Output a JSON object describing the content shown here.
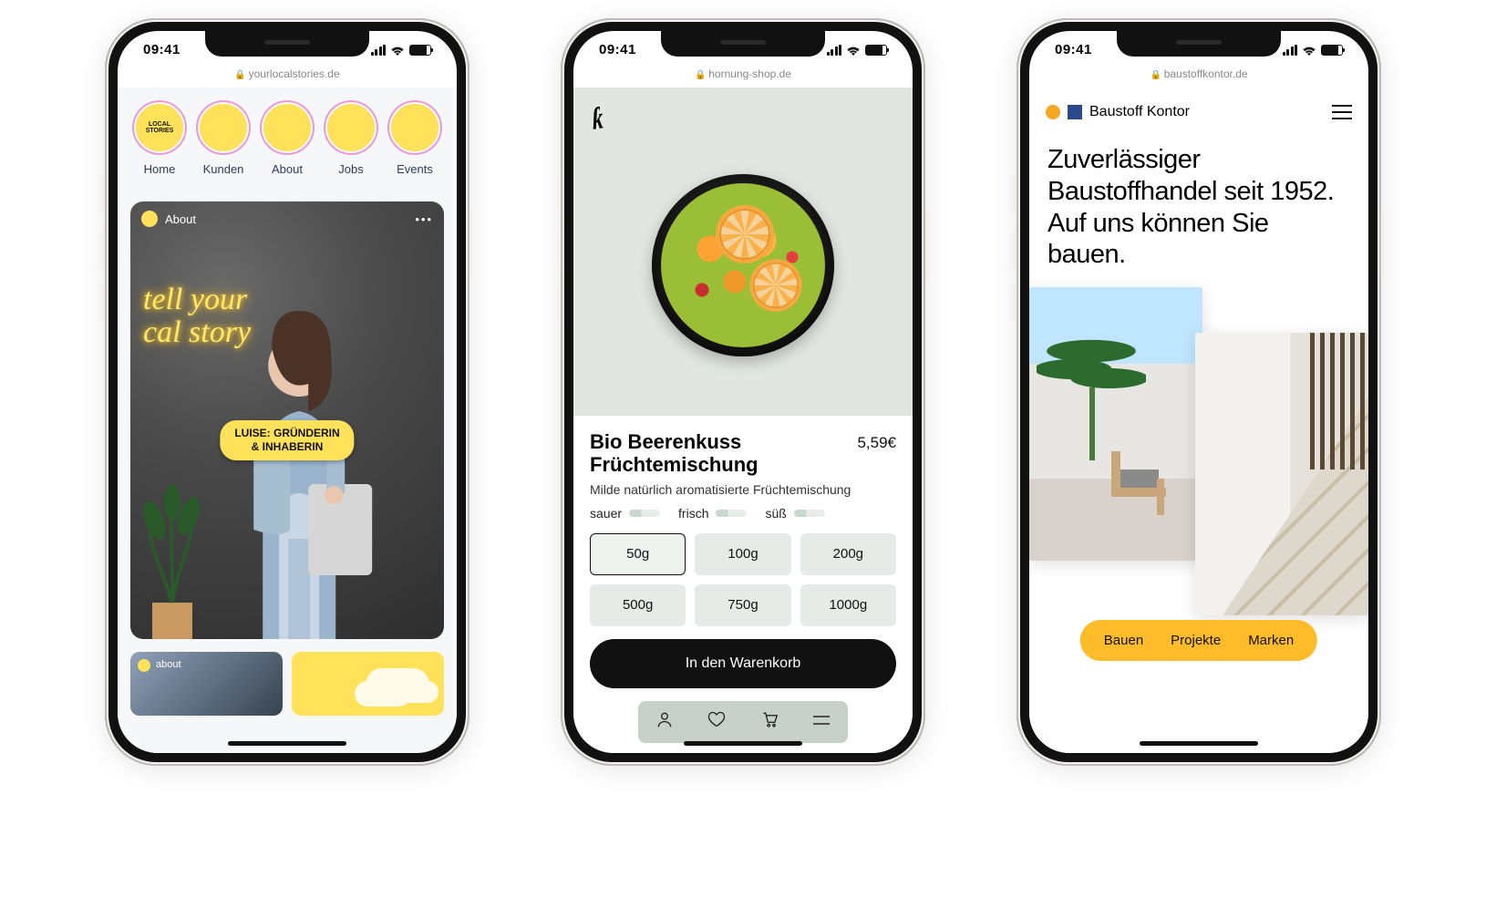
{
  "status": {
    "time": "09:41"
  },
  "phones": [
    {
      "url": "yourlocalstories.de",
      "nav": {
        "logo_text": "LOCAL\nSTORIES",
        "items": [
          "Home",
          "Kunden",
          "About",
          "Jobs",
          "Events"
        ]
      },
      "story": {
        "header_label": "About",
        "more": "•••",
        "neon_line1": "tell your",
        "neon_line2": "cal story",
        "badge": "LUISE: GRÜNDERIN\n& INHABERIN"
      },
      "thumb_label": "about"
    },
    {
      "url": "hornung-shop.de",
      "product": {
        "title": "Bio Beerenkuss Früchtemischung",
        "price": "5,59€",
        "subtitle": "Milde natürlich aromatisierte Früchtemischung",
        "taste": [
          "sauer",
          "frisch",
          "süß"
        ],
        "sizes": [
          "50g",
          "100g",
          "200g",
          "500g",
          "750g",
          "1000g"
        ],
        "selected_size_index": 0,
        "cart_button": "In den Warenkorb"
      },
      "bottom_icons": [
        "user-icon",
        "heart-icon",
        "cart-icon",
        "menu-icon"
      ]
    },
    {
      "url": "baustoffkontor.de",
      "brand": "Baustoff Kontor",
      "hero": "Zuverlässiger Baustoffhandel seit 1952. Auf uns können Sie bauen.",
      "pill": [
        "Bauen",
        "Projekte",
        "Marken"
      ]
    }
  ]
}
